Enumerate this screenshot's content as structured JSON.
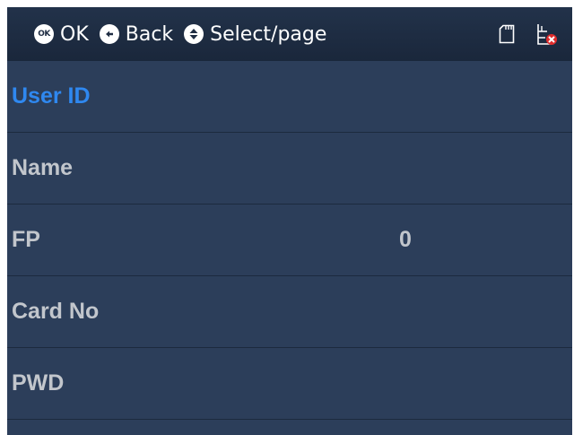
{
  "header": {
    "ok_label": "OK",
    "back_label": "Back",
    "select_label": "Select/page",
    "icons": {
      "ok": "ok-button-icon",
      "back": "back-arrow-icon",
      "select": "up-down-icon",
      "sd": "sd-card-icon",
      "network": "network-disconnected-icon"
    }
  },
  "fields": [
    {
      "label": "User ID",
      "value": "",
      "selected": true
    },
    {
      "label": "Name",
      "value": ""
    },
    {
      "label": "FP",
      "value": "0"
    },
    {
      "label": "Card No",
      "value": ""
    },
    {
      "label": "PWD",
      "value": ""
    }
  ],
  "colors": {
    "background": "#2c3e5a",
    "header": "#1f2d43",
    "selected_text": "#2f88f0",
    "text": "#c2c6cc"
  }
}
